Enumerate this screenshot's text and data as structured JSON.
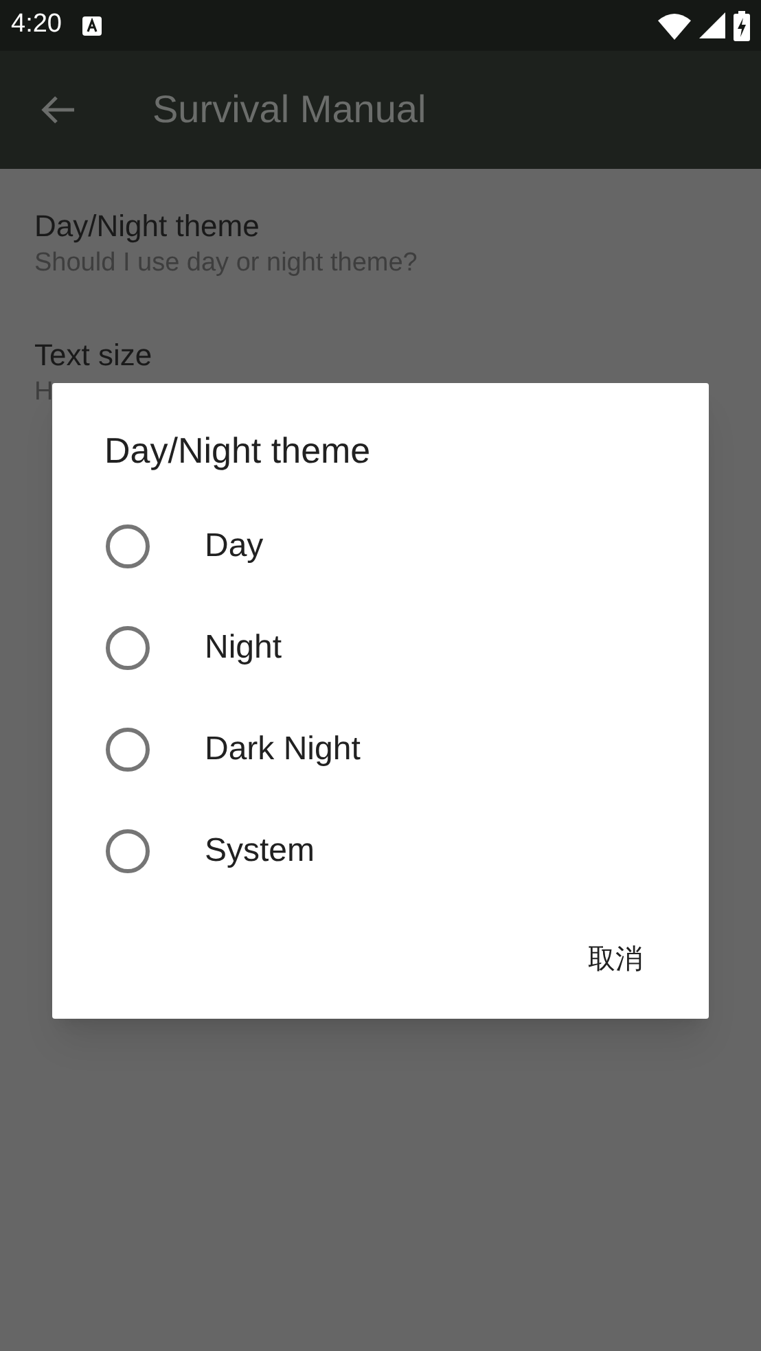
{
  "status_bar": {
    "time": "4:20"
  },
  "toolbar": {
    "title": "Survival Manual"
  },
  "preferences": [
    {
      "title": "Day/Night theme",
      "summary": "Should I use day or night theme?"
    },
    {
      "title": "Text size",
      "summary": "H"
    }
  ],
  "dialog": {
    "title": "Day/Night theme",
    "options": [
      {
        "label": "Day",
        "selected": false
      },
      {
        "label": "Night",
        "selected": false
      },
      {
        "label": "Dark Night",
        "selected": false
      },
      {
        "label": "System",
        "selected": false
      }
    ],
    "buttons": [
      "取消"
    ]
  }
}
